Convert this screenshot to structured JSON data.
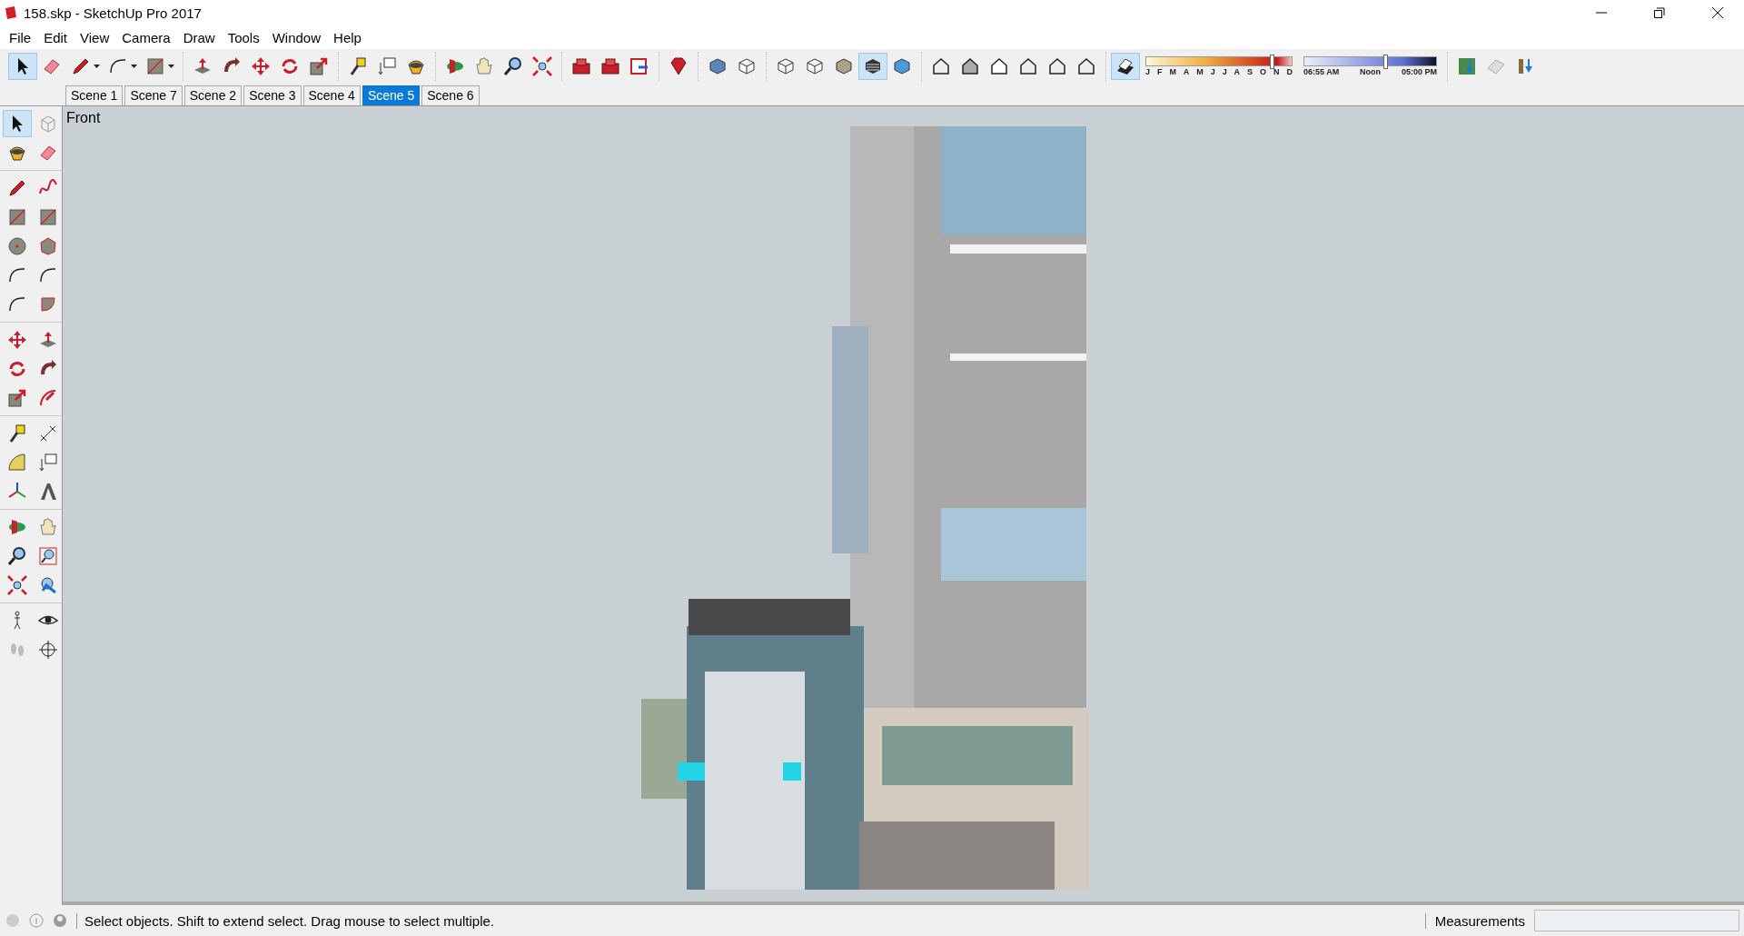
{
  "window": {
    "title": "158.skp - SketchUp Pro 2017"
  },
  "menu": [
    "File",
    "Edit",
    "View",
    "Camera",
    "Draw",
    "Tools",
    "Window",
    "Help"
  ],
  "toolbar": [
    [
      {
        "kind": "select",
        "selected": true,
        "menu": false
      },
      {
        "kind": "eraser",
        "selected": false,
        "menu": false
      },
      {
        "kind": "pencil",
        "selected": false,
        "menu": true
      },
      {
        "kind": "arc",
        "selected": false,
        "menu": true
      },
      {
        "kind": "rectangle",
        "selected": false,
        "menu": true
      }
    ],
    [
      {
        "kind": "pushpull",
        "selected": false,
        "menu": false
      },
      {
        "kind": "followme",
        "selected": false,
        "menu": false
      },
      {
        "kind": "move",
        "selected": false,
        "menu": false
      },
      {
        "kind": "rotate",
        "selected": false,
        "menu": false
      },
      {
        "kind": "scale",
        "selected": false,
        "menu": false
      }
    ],
    [
      {
        "kind": "tape",
        "selected": false,
        "menu": false
      },
      {
        "kind": "text",
        "selected": false,
        "menu": false
      },
      {
        "kind": "paint",
        "selected": false,
        "menu": false
      }
    ],
    [
      {
        "kind": "orbit",
        "selected": false,
        "menu": false
      },
      {
        "kind": "pan",
        "selected": false,
        "menu": false
      },
      {
        "kind": "zoom",
        "selected": false,
        "menu": false
      },
      {
        "kind": "extents",
        "selected": false,
        "menu": false
      }
    ],
    [
      {
        "kind": "warehouse",
        "selected": false,
        "menu": false
      },
      {
        "kind": "extensions",
        "selected": false,
        "menu": false
      },
      {
        "kind": "layout",
        "selected": false,
        "menu": false
      }
    ],
    [
      {
        "kind": "ruby",
        "selected": false,
        "menu": false
      }
    ],
    [
      {
        "kind": "xray",
        "selected": false,
        "menu": false
      },
      {
        "kind": "backedges",
        "selected": false,
        "menu": false
      }
    ],
    [
      {
        "kind": "wireframe",
        "selected": false,
        "menu": false
      },
      {
        "kind": "hidden",
        "selected": false,
        "menu": false
      },
      {
        "kind": "shaded",
        "selected": false,
        "menu": false
      },
      {
        "kind": "textured",
        "selected": true,
        "menu": false
      },
      {
        "kind": "monochrome",
        "selected": false,
        "menu": false
      }
    ],
    [
      {
        "kind": "iso",
        "selected": false,
        "menu": false
      },
      {
        "kind": "top",
        "selected": false,
        "menu": false
      },
      {
        "kind": "front",
        "selected": false,
        "menu": false
      },
      {
        "kind": "right",
        "selected": false,
        "menu": false
      },
      {
        "kind": "back",
        "selected": false,
        "menu": false
      },
      {
        "kind": "left",
        "selected": false,
        "menu": false
      }
    ]
  ],
  "shadows": {
    "on": true,
    "months": [
      "J",
      "F",
      "M",
      "A",
      "M",
      "J",
      "J",
      "A",
      "S",
      "O",
      "N",
      "D"
    ],
    "month_slider": {
      "level": 0.85
    },
    "times": [
      "06:55 AM",
      "Noon",
      "05:00 PM"
    ],
    "time_slider": {
      "level": 0.6
    }
  },
  "location_tools": [
    {
      "kind": "geolocation"
    },
    {
      "kind": "terrain"
    },
    {
      "kind": "addlocation"
    }
  ],
  "scenes": [
    {
      "label": "Scene 1",
      "selected": false
    },
    {
      "label": "Scene 7",
      "selected": false
    },
    {
      "label": "Scene 2",
      "selected": false
    },
    {
      "label": "Scene 3",
      "selected": false
    },
    {
      "label": "Scene 4",
      "selected": false
    },
    {
      "label": "Scene 5",
      "selected": true
    },
    {
      "label": "Scene 6",
      "selected": false
    }
  ],
  "left_toolbar": [
    [
      [
        {
          "kind": "select",
          "selected": true
        },
        {
          "kind": "component",
          "selected": false
        }
      ],
      [
        {
          "kind": "paint",
          "selected": false
        },
        {
          "kind": "eraser",
          "selected": false
        }
      ]
    ],
    [
      [
        {
          "kind": "pencil",
          "selected": false
        },
        {
          "kind": "freehand",
          "selected": false
        }
      ],
      [
        {
          "kind": "rectangle",
          "selected": false
        },
        {
          "kind": "rotrect",
          "selected": false
        }
      ],
      [
        {
          "kind": "circle",
          "selected": false
        },
        {
          "kind": "polygon",
          "selected": false
        }
      ],
      [
        {
          "kind": "arc",
          "selected": false
        },
        {
          "kind": "arc2",
          "selected": false
        }
      ],
      [
        {
          "kind": "arc3",
          "selected": false
        },
        {
          "kind": "pie",
          "selected": false
        }
      ]
    ],
    [
      [
        {
          "kind": "move",
          "selected": false
        },
        {
          "kind": "pushpull",
          "selected": false
        }
      ],
      [
        {
          "kind": "rotate",
          "selected": false
        },
        {
          "kind": "followme",
          "selected": false
        }
      ],
      [
        {
          "kind": "scale",
          "selected": false
        },
        {
          "kind": "offset",
          "selected": false
        }
      ]
    ],
    [
      [
        {
          "kind": "tape",
          "selected": false
        },
        {
          "kind": "dimension",
          "selected": false
        }
      ],
      [
        {
          "kind": "protractor",
          "selected": false
        },
        {
          "kind": "text",
          "selected": false
        }
      ],
      [
        {
          "kind": "axes",
          "selected": false
        },
        {
          "kind": "text3d",
          "selected": false
        }
      ]
    ],
    [
      [
        {
          "kind": "orbit",
          "selected": false
        },
        {
          "kind": "pan",
          "selected": false
        }
      ],
      [
        {
          "kind": "zoom",
          "selected": false
        },
        {
          "kind": "zoomwindow",
          "selected": false
        }
      ],
      [
        {
          "kind": "extents",
          "selected": false
        },
        {
          "kind": "previous",
          "selected": false
        }
      ]
    ],
    [
      [
        {
          "kind": "walk",
          "selected": false
        },
        {
          "kind": "look",
          "selected": false
        }
      ],
      [
        {
          "kind": "footprints",
          "selected": false
        },
        {
          "kind": "section",
          "selected": false
        }
      ]
    ]
  ],
  "viewport": {
    "view_label": "Front"
  },
  "status_bar": {
    "message": "Select objects. Shift to extend select. Drag mouse to select multiple.",
    "measurements_label": "Measurements"
  }
}
